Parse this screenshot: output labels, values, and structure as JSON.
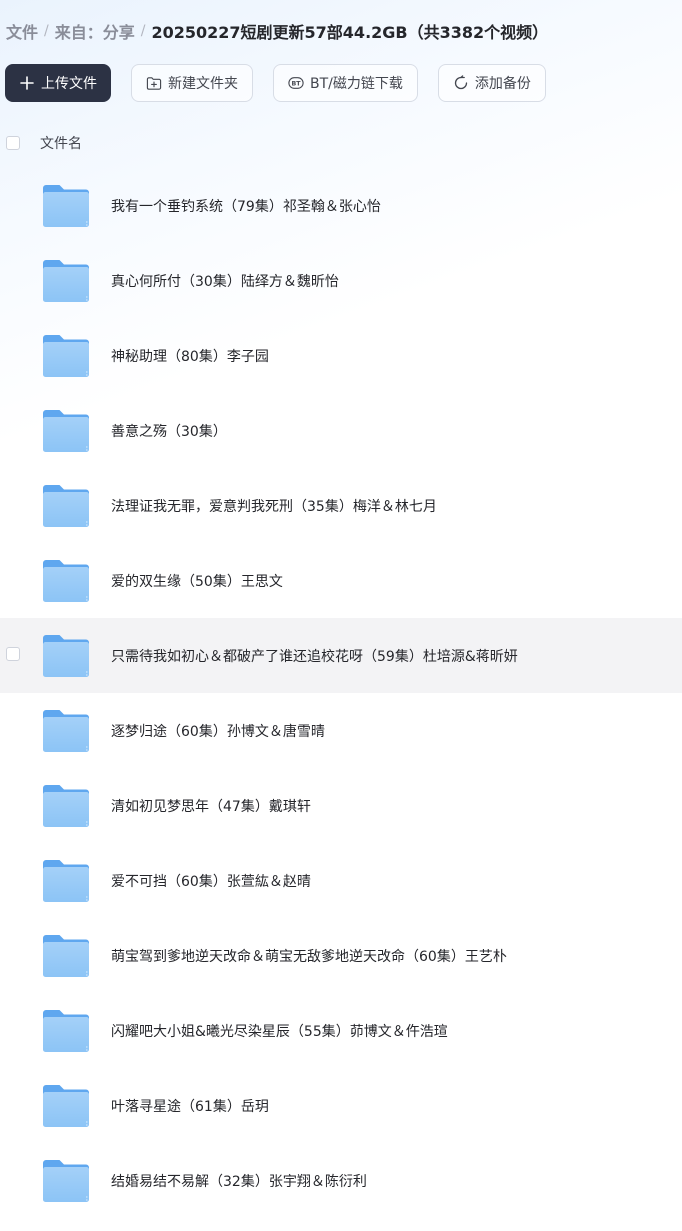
{
  "breadcrumb": {
    "items": [
      "文件",
      "来自：分享"
    ],
    "separator": "/",
    "current": "20250227短剧更新57部44.2GB（共3382个视频）"
  },
  "toolbar": {
    "upload_label": "上传文件",
    "new_folder_label": "新建文件夹",
    "bt_label": "BT/磁力链下载",
    "backup_label": "添加备份"
  },
  "list": {
    "header_name": "文件名",
    "items": [
      {
        "name": "我有一个垂钓系统（79集）祁圣翰＆张心怡"
      },
      {
        "name": "真心何所付（30集）陆绎方＆魏昕怡"
      },
      {
        "name": "神秘助理（80集）李子园"
      },
      {
        "name": "善意之殇（30集）"
      },
      {
        "name": "法理证我无罪，爱意判我死刑（35集）梅洋＆林七月"
      },
      {
        "name": "爱的双生缘（50集）王思文"
      },
      {
        "name": "只需待我如初心＆都破产了谁还追校花呀（59集）杜培源&蒋昕妍"
      },
      {
        "name": "逐梦归途（60集）孙博文＆唐雪晴"
      },
      {
        "name": "清如初见梦思年（47集）戴琪轩"
      },
      {
        "name": "爱不可挡（60集）张萱紘＆赵晴"
      },
      {
        "name": "萌宝驾到爹地逆天改命＆萌宝无敌爹地逆天改命（60集）王艺朴"
      },
      {
        "name": "闪耀吧大小姐&曦光尽染星辰（55集）茆博文＆仵浩瑄"
      },
      {
        "name": "叶落寻星途（61集）岳玥"
      },
      {
        "name": "结婚易结不易解（32集）张宇翔＆陈衍利"
      }
    ]
  },
  "colors": {
    "primary_button": "#2c3244",
    "folder_blue": "#7fbcf4",
    "hover_row": "#f3f3f5"
  },
  "icons": {
    "folder": "folder-icon",
    "upload": "plus-icon",
    "new_folder": "folder-plus-icon",
    "bt": "bt-icon",
    "backup": "sync-icon"
  }
}
